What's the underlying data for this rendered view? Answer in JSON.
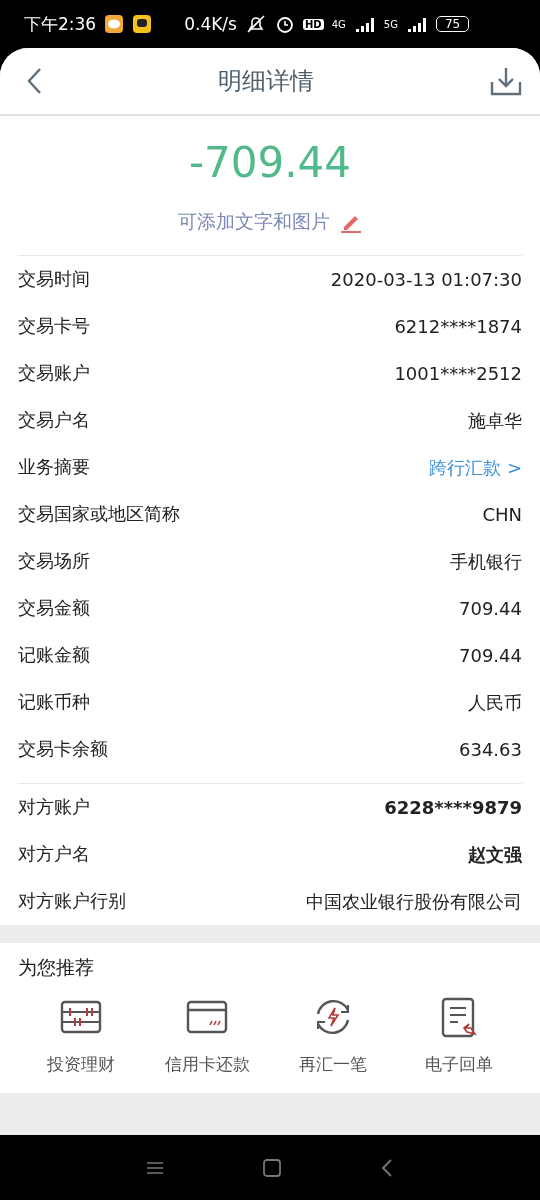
{
  "status_bar": {
    "time": "下午2:36",
    "speed": "0.4K/s",
    "hd": "HD",
    "net1": "4G",
    "net2": "5G",
    "battery": "75"
  },
  "header": {
    "title": "明细详情"
  },
  "amount": "-709.44",
  "note": "可添加文字和图片",
  "details": [
    {
      "label": "交易时间",
      "value": "2020-03-13 01:07:30",
      "kind": "text"
    },
    {
      "label": "交易卡号",
      "value": "6212****1874",
      "kind": "text"
    },
    {
      "label": "交易账户",
      "value": "1001****2512",
      "kind": "text"
    },
    {
      "label": "交易户名",
      "value": "施卓华",
      "kind": "text"
    },
    {
      "label": "业务摘要",
      "value": "跨行汇款 >",
      "kind": "link"
    },
    {
      "label": "交易国家或地区简称",
      "value": "CHN",
      "kind": "text"
    },
    {
      "label": "交易场所",
      "value": "手机银行",
      "kind": "text"
    },
    {
      "label": "交易金额",
      "value": "709.44",
      "kind": "text"
    },
    {
      "label": "记账金额",
      "value": "709.44",
      "kind": "text"
    },
    {
      "label": "记账币种",
      "value": "人民币",
      "kind": "text"
    },
    {
      "label": "交易卡余额",
      "value": "634.63",
      "kind": "text"
    }
  ],
  "counterparty": [
    {
      "label": "对方账户",
      "value": "6228****9879",
      "kind": "bold"
    },
    {
      "label": "对方户名",
      "value": "赵文强",
      "kind": "bold"
    },
    {
      "label": "对方账户行别",
      "value": "中国农业银行股份有限公司",
      "kind": "text"
    }
  ],
  "recommend": {
    "title": "为您推荐",
    "items": [
      {
        "label": "投资理财",
        "kind": "abacus"
      },
      {
        "label": "信用卡还款",
        "kind": "card"
      },
      {
        "label": "再汇一笔",
        "kind": "refresh"
      },
      {
        "label": "电子回单",
        "kind": "receipt"
      }
    ]
  }
}
